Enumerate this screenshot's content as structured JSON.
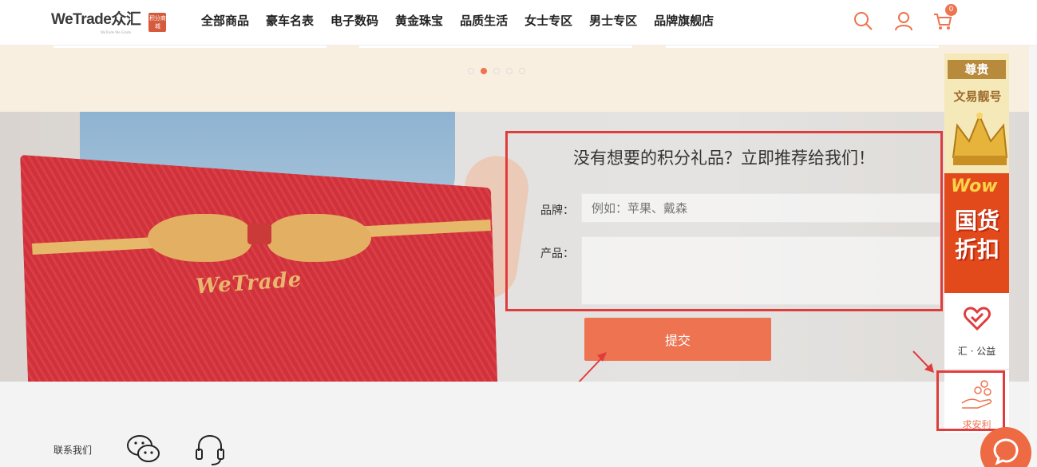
{
  "header": {
    "logo": {
      "text": "WeTrade众汇",
      "subtitle": "WeTrade We Grade",
      "badge": "积分商城"
    },
    "nav": [
      "全部商品",
      "豪车名表",
      "电子数码",
      "黄金珠宝",
      "品质生活",
      "女士专区",
      "男士专区",
      "品牌旗舰店"
    ],
    "cart_count": "0",
    "icons": [
      "search-icon",
      "user-icon",
      "cart-icon"
    ]
  },
  "carousel": {
    "dot_count": 5,
    "active_index": 1
  },
  "hero": {
    "gift_brand": "WeTrade"
  },
  "form": {
    "title": "没有想要的积分礼品？立即推荐给我们！",
    "brand_label": "品牌：",
    "brand_placeholder": "例如：苹果、戴森",
    "product_label": "产品：",
    "product_value": "",
    "submit_label": "提交"
  },
  "sidebar": {
    "promo_top_title": "尊贵",
    "promo_top_sub": "文易靓号",
    "promo_bottom_wow": "Wow",
    "promo_bottom_text": "国货折扣",
    "charity_label": "汇 · 公益",
    "benefit_label": "求安利"
  },
  "footer": {
    "contact_label": "联系我们",
    "icons": [
      "wechat-icon",
      "customer-service-icon"
    ]
  },
  "colors": {
    "accent": "#ee7350",
    "highlight": "#e03c3c",
    "promo_banner": "#f8efe0"
  }
}
